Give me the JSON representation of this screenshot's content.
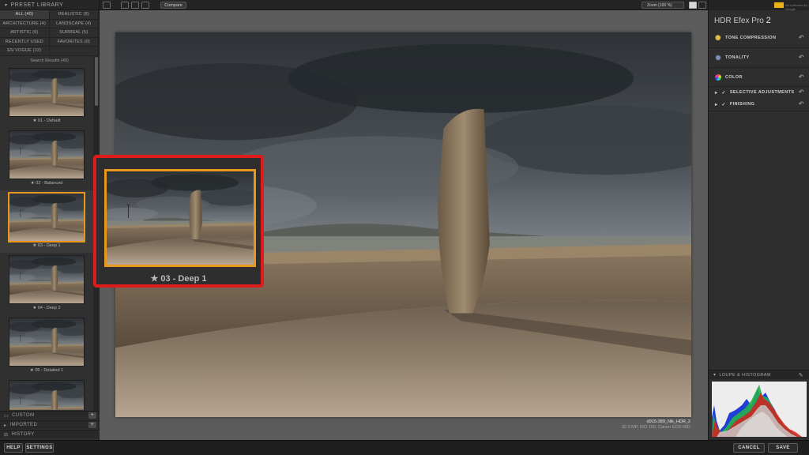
{
  "preset_library": {
    "title": "PRESET LIBRARY",
    "categories": [
      {
        "label": "ALL (40)",
        "active": true
      },
      {
        "label": "REALISTIC (8)",
        "active": false
      },
      {
        "label": "ARCHITECTURE (4)",
        "active": false
      },
      {
        "label": "LANDSCAPE (4)",
        "active": false
      },
      {
        "label": "ARTISTIC (6)",
        "active": false
      },
      {
        "label": "SURREAL (5)",
        "active": false
      },
      {
        "label": "RECENTLY USED",
        "active": false
      },
      {
        "label": "FAVORITES (0)",
        "active": false
      },
      {
        "label": "EN VOGUE (12)",
        "active": false
      }
    ],
    "search_results": "Search Results (40)",
    "presets": [
      {
        "label": "★ 01 - Default",
        "selected": false
      },
      {
        "label": "★ 02 - Balanced",
        "selected": false
      },
      {
        "label": "★ 03 - Deep 1",
        "selected": true
      },
      {
        "label": "★ 04 - Deep 2",
        "selected": false
      },
      {
        "label": "★ 05 - Detailed 1",
        "selected": false
      },
      {
        "label": "",
        "selected": false
      }
    ],
    "sections": {
      "custom": "CUSTOM",
      "imported": "IMPORTED",
      "history": "HISTORY"
    }
  },
  "toolbar": {
    "compare": "Compare",
    "zoom": "Zoom (100 %)"
  },
  "callout": {
    "label": "★ 03 - Deep 1"
  },
  "photo_info": {
    "filename": "d915-389_Nik_HDR_2",
    "meta": "32.3 MP, ISO 100, Canon EOS 60D"
  },
  "right_panel": {
    "brand_text": "nik collection by Google",
    "app_title_a": "HDR Efex Pro",
    "app_title_b": "2",
    "adjustments": [
      {
        "label": "TONE COMPRESSION",
        "icon": "sun-icon"
      },
      {
        "label": "TONALITY",
        "icon": "tonality-icon"
      },
      {
        "label": "COLOR",
        "icon": "color-wheel-icon"
      },
      {
        "label": "SELECTIVE ADJUSTMENTS",
        "icon": "checkbox-icon"
      },
      {
        "label": "FINISHING",
        "icon": "checkbox-icon"
      }
    ],
    "loupe": "LOUPE & HISTOGRAM"
  },
  "bottom": {
    "help": "HELP",
    "settings": "SETTINGS",
    "cancel": "CANCEL",
    "save": "SAVE"
  },
  "colors": {
    "accent_orange": "#e8961e",
    "callout_red": "#e01b1b",
    "nik_yellow": "#e8b219"
  }
}
